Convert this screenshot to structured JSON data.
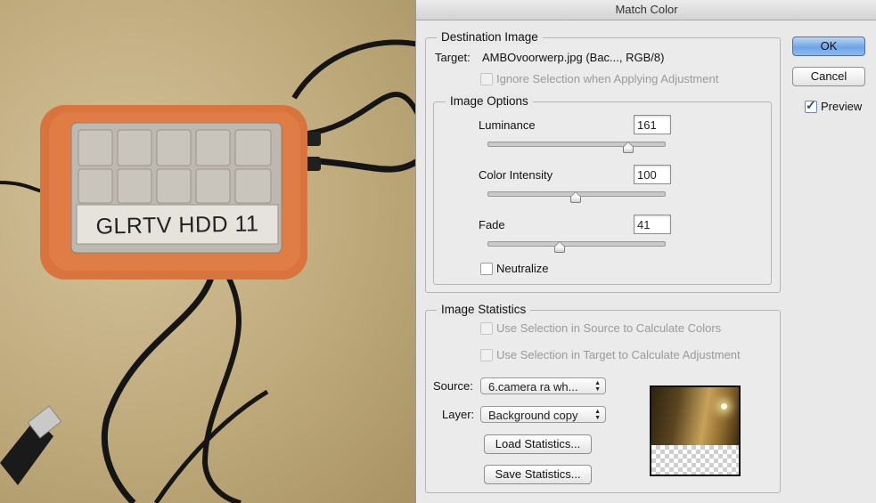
{
  "photo": {
    "device_label": "GLRTV HDD 11"
  },
  "dialog": {
    "title": "Match Color",
    "destination": {
      "legend": "Destination Image",
      "target_label": "Target:",
      "target_value": "AMBOvoorwerp.jpg (Bac..., RGB/8)",
      "ignore_selection_label": "Ignore Selection when Applying Adjustment",
      "ignore_selection_checked": false
    },
    "image_options": {
      "legend": "Image Options",
      "luminance_label": "Luminance",
      "luminance_value": "161",
      "luminance_level": 0.8,
      "color_intensity_label": "Color Intensity",
      "color_intensity_value": "100",
      "color_intensity_level": 0.5,
      "fade_label": "Fade",
      "fade_value": "41",
      "fade_level": 0.41,
      "neutralize_label": "Neutralize",
      "neutralize_checked": false
    },
    "statistics": {
      "legend": "Image Statistics",
      "use_source_label": "Use Selection in Source to Calculate Colors",
      "use_target_label": "Use Selection in Target to Calculate Adjustment",
      "source_label": "Source:",
      "source_value": "6.camera ra wh...",
      "layer_label": "Layer:",
      "layer_value": "Background copy",
      "load_label": "Load Statistics...",
      "save_label": "Save Statistics..."
    },
    "ok_label": "OK",
    "cancel_label": "Cancel",
    "preview_label": "Preview",
    "preview_checked": true
  },
  "colors": {
    "default_button": "#6fa5e7",
    "dialog_bg": "#e9e9e9",
    "case_orange": "#d9743f"
  },
  "icons": {
    "slider_thumb": "triangle-thumb-icon",
    "popup_arrows": "updown-arrows-icon",
    "checkmark": "checkmark-icon"
  }
}
